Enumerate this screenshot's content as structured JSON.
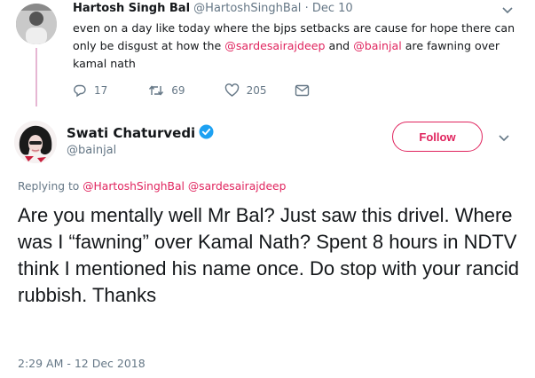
{
  "reply_tweet": {
    "author_name": "Hartosh Singh Bal",
    "author_handle": "@HartoshSinghBal",
    "separator": "·",
    "date": "Dec 10",
    "text_part1": "even on a day like today where the bjps setbacks are cause for hope there can only be disgust at how the ",
    "mention1": "@sardesairajdeep",
    "text_part2": " and ",
    "mention2": "@bainjal",
    "text_part3": " are fawning over kamal nath",
    "reply_count": "17",
    "retweet_count": "69",
    "like_count": "205",
    "icons": [
      "reply-icon",
      "retweet-icon",
      "heart-icon",
      "dm-envelope-icon",
      "chevron-down-icon"
    ]
  },
  "main_tweet": {
    "author_name": "Swati Chaturvedi",
    "author_handle": "@bainjal",
    "follow_label": "Follow",
    "replying_label": "Replying to",
    "replying_mention1": "@HartoshSinghBal",
    "replying_mention2": "@sardesairajdeep",
    "text": "Are you mentally well Mr Bal? Just saw this drivel. Where was I “fawning” over Kamal Nath? Spent 8 hours in NDTV think I mentioned his name once. Do stop with your rancid rubbish. Thanks",
    "timestamp": "2:29 AM - 12 Dec 2018",
    "icons": [
      "verified-badge-icon",
      "chevron-down-icon"
    ]
  },
  "colors": {
    "accent": "#e0245e",
    "secondary_text": "#657786",
    "primary_text": "#14171a",
    "verified": "#1da1f2",
    "thread_line": "#e6b6d3"
  }
}
